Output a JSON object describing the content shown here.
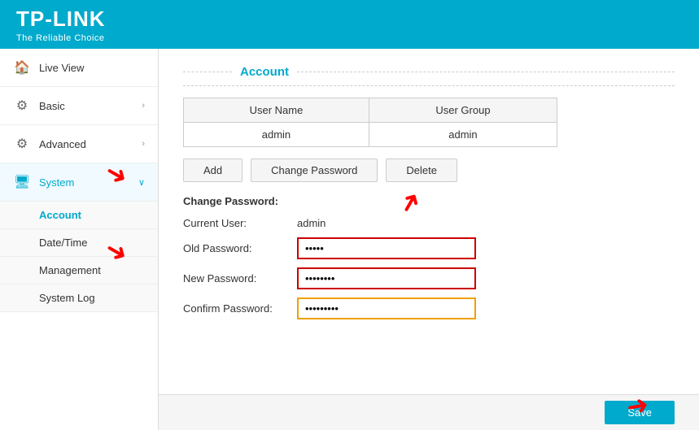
{
  "header": {
    "brand": "TP-LINK",
    "tagline": "The Reliable Choice"
  },
  "sidebar": {
    "items": [
      {
        "id": "live-view",
        "label": "Live View",
        "icon": "🏠",
        "active": false,
        "hasArrow": false,
        "hasArrowDown": false
      },
      {
        "id": "basic",
        "label": "Basic",
        "icon": "⚙",
        "active": false,
        "hasArrow": true,
        "hasArrowDown": false
      },
      {
        "id": "advanced",
        "label": "Advanced",
        "icon": "⚙",
        "active": false,
        "hasArrow": true,
        "hasArrowDown": false
      },
      {
        "id": "system",
        "label": "System",
        "icon": "🖥",
        "active": true,
        "hasArrow": false,
        "hasArrowDown": true
      }
    ],
    "subItems": [
      {
        "id": "account",
        "label": "Account",
        "active": true
      },
      {
        "id": "datetime",
        "label": "Date/Time",
        "active": false
      },
      {
        "id": "management",
        "label": "Management",
        "active": false
      },
      {
        "id": "system-log",
        "label": "System Log",
        "active": false
      }
    ]
  },
  "content": {
    "sectionTitle": "Account",
    "table": {
      "headers": [
        "User Name",
        "User Group"
      ],
      "rows": [
        {
          "username": "admin",
          "group": "admin"
        }
      ]
    },
    "buttons": {
      "add": "Add",
      "changePassword": "Change Password",
      "delete": "Delete"
    },
    "changePasswordSection": {
      "title": "Change Password:",
      "currentUserLabel": "Current User:",
      "currentUserValue": "admin",
      "oldPasswordLabel": "Old Password:",
      "oldPasswordValue": "•••••",
      "newPasswordLabel": "New Password:",
      "newPasswordValue": "••••••••",
      "confirmPasswordLabel": "Confirm Password:",
      "confirmPasswordValue": "•••••••••"
    },
    "saveButton": "Save"
  }
}
